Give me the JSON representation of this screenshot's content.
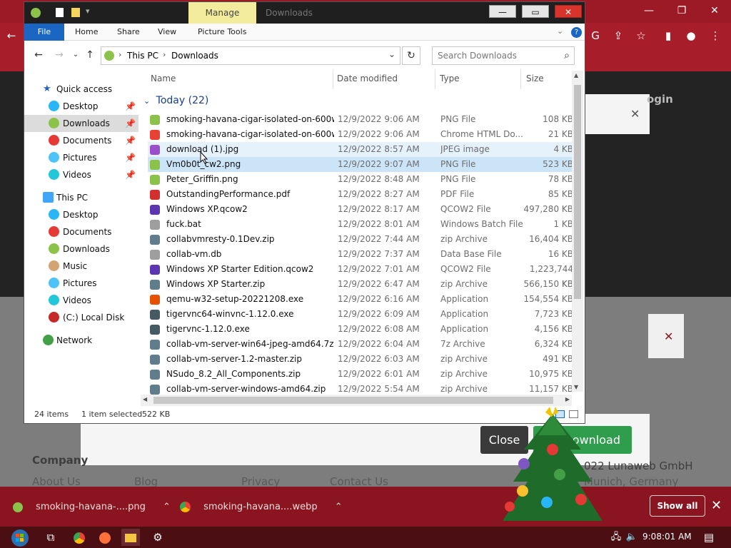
{
  "browser": {
    "window_controls": [
      "—",
      "❐",
      "✕"
    ],
    "page": {
      "login_text": "ogin",
      "close_x": "✕",
      "notice_close": "✕",
      "close_button": "Close",
      "download_button": "Download",
      "footer": {
        "company": "Company",
        "about": "About Us",
        "blog": "Blog",
        "privacy": "Privacy",
        "contact": "Contact Us",
        "copyright": "022 Lunaweb GmbH",
        "city": "Munich, Germany"
      }
    }
  },
  "shelf": {
    "items": [
      {
        "label": "smoking-havana-....png",
        "icon": "png-file-icon"
      },
      {
        "label": "smoking-havana....webp",
        "icon": "chrome-icon"
      }
    ],
    "show_all": "Show all",
    "close": "✕"
  },
  "taskbar": {
    "time": "9:08:01 AM"
  },
  "explorer": {
    "manage_tab": "Manage",
    "title": "Downloads",
    "ribbon_tabs": [
      "File",
      "Home",
      "Share",
      "View",
      "Picture Tools"
    ],
    "breadcrumb": [
      "This PC",
      "Downloads"
    ],
    "search_placeholder": "Search Downloads",
    "nav": {
      "quick_access": "Quick access",
      "quick": [
        "Desktop",
        "Downloads",
        "Documents",
        "Pictures",
        "Videos"
      ],
      "this_pc": "This PC",
      "pc": [
        "Desktop",
        "Documents",
        "Downloads",
        "Music",
        "Pictures",
        "Videos",
        "(C:) Local Disk"
      ],
      "network": "Network"
    },
    "columns": [
      "Name",
      "Date modified",
      "Type",
      "Size"
    ],
    "group": "Today (22)",
    "files": [
      {
        "name": "smoking-havana-cigar-isolated-on-600w...",
        "date": "12/9/2022 9:06 AM",
        "type": "PNG File",
        "size": "108 KB",
        "color": "#8bc34a"
      },
      {
        "name": "smoking-havana-cigar-isolated-on-600w...",
        "date": "12/9/2022 9:06 AM",
        "type": "Chrome HTML Do...",
        "size": "21 KB",
        "color": "#e94235"
      },
      {
        "name": "download (1).jpg",
        "date": "12/9/2022 8:57 AM",
        "type": "JPEG image",
        "size": "4 KB",
        "color": "#9c4dcc"
      },
      {
        "name": "Vm0b0t_cw2.png",
        "date": "12/9/2022 9:07 AM",
        "type": "PNG File",
        "size": "523 KB",
        "color": "#8bc34a"
      },
      {
        "name": "Peter_Griffin.png",
        "date": "12/9/2022 8:48 AM",
        "type": "PNG File",
        "size": "78 KB",
        "color": "#8bc34a"
      },
      {
        "name": "OutstandingPerformance.pdf",
        "date": "12/9/2022 8:27 AM",
        "type": "PDF File",
        "size": "85 KB",
        "color": "#d32f2f"
      },
      {
        "name": "Windows XP.qcow2",
        "date": "12/9/2022 8:17 AM",
        "type": "QCOW2 File",
        "size": "497,280 KB",
        "color": "#5e35b1"
      },
      {
        "name": "fuck.bat",
        "date": "12/9/2022 8:01 AM",
        "type": "Windows Batch File",
        "size": "1 KB",
        "color": "#9e9e9e"
      },
      {
        "name": "collabvmresty-0.1Dev.zip",
        "date": "12/9/2022 7:44 AM",
        "type": "zip Archive",
        "size": "16,404 KB",
        "color": "#607d8b"
      },
      {
        "name": "collab-vm.db",
        "date": "12/9/2022 7:37 AM",
        "type": "Data Base File",
        "size": "16 KB",
        "color": "#9e9e9e"
      },
      {
        "name": "Windows XP Starter Edition.qcow2",
        "date": "12/9/2022 7:01 AM",
        "type": "QCOW2 File",
        "size": "1,223,744 KB",
        "color": "#5e35b1"
      },
      {
        "name": "Windows XP Starter.zip",
        "date": "12/9/2022 6:47 AM",
        "type": "zip Archive",
        "size": "566,150 KB",
        "color": "#607d8b"
      },
      {
        "name": "qemu-w32-setup-20221208.exe",
        "date": "12/9/2022 6:16 AM",
        "type": "Application",
        "size": "154,554 KB",
        "color": "#e65100"
      },
      {
        "name": "tigervnc64-winvnc-1.12.0.exe",
        "date": "12/9/2022 6:09 AM",
        "type": "Application",
        "size": "7,723 KB",
        "color": "#455a64"
      },
      {
        "name": "tigervnc-1.12.0.exe",
        "date": "12/9/2022 6:08 AM",
        "type": "Application",
        "size": "4,156 KB",
        "color": "#455a64"
      },
      {
        "name": "collab-vm-server-win64-jpeg-amd64.7z",
        "date": "12/9/2022 6:04 AM",
        "type": "7z Archive",
        "size": "6,324 KB",
        "color": "#607d8b"
      },
      {
        "name": "collab-vm-server-1.2-master.zip",
        "date": "12/9/2022 6:03 AM",
        "type": "zip Archive",
        "size": "491 KB",
        "color": "#607d8b"
      },
      {
        "name": "NSudo_8.2_All_Components.zip",
        "date": "12/9/2022 6:01 AM",
        "type": "zip Archive",
        "size": "10,975 KB",
        "color": "#607d8b"
      },
      {
        "name": "collab-vm-server-windows-amd64.zip",
        "date": "12/9/2022 5:54 AM",
        "type": "zip Archive",
        "size": "11,157 KB",
        "color": "#607d8b"
      }
    ],
    "status": {
      "items": "24 items",
      "selected": "1 item selected",
      "size": "522 KB"
    }
  }
}
